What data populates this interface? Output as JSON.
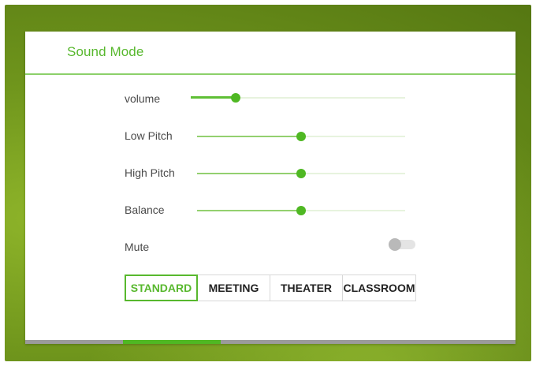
{
  "dialog": {
    "title": "Sound Mode"
  },
  "controls": {
    "volume": {
      "label": "volume",
      "level": 0.21
    },
    "low_pitch": {
      "label": "Low Pitch",
      "level": 0.5
    },
    "high_pitch": {
      "label": "High Pitch",
      "level": 0.5
    },
    "balance": {
      "label": "Balance",
      "level": 0.5
    },
    "mute": {
      "label": "Mute",
      "on": false
    }
  },
  "modes": {
    "items": [
      "STANDARD",
      "MEETING",
      "THEATER",
      "CLASSROOM"
    ],
    "selected": "STANDARD"
  },
  "page_indicator": {
    "active_segment": 2,
    "segment_count": 5
  },
  "colors": {
    "accent": "#58b82e",
    "thumb": "#4fb823",
    "background_green": "#6f951c"
  }
}
